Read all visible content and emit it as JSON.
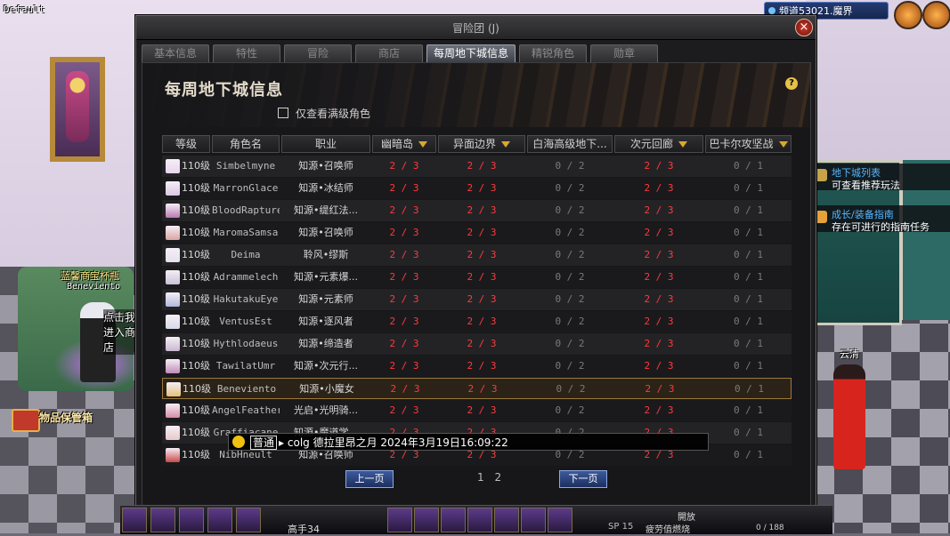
{
  "scene": {
    "corner_label": "Default",
    "channel": "频道53021.魔界",
    "shop_name": "蓝馨商宝杯瓶",
    "player_name": "Beneviento",
    "shop_hint": "点击我进入商店",
    "storage_label": "物品保管箱",
    "npc_name": "云清",
    "guide_items": [
      {
        "title": "地下城列表",
        "sub": "可查看推荐玩法"
      },
      {
        "title": "成长/装备指南",
        "sub": "存在可进行的指南任务"
      }
    ]
  },
  "window": {
    "title": "冒险团 (J)",
    "close": "×",
    "tabs": [
      "基本信息",
      "特性",
      "冒险",
      "商店",
      "每周地下城信息",
      "精锐角色",
      "勋章"
    ],
    "active_tab": 4,
    "heading": "每周地下城信息",
    "help": "?",
    "filter_label": "仅查看满级角色"
  },
  "table": {
    "headers": [
      "等级",
      "角色名",
      "职业",
      "幽暗岛",
      "异面边界",
      "白海高级地下...",
      "次元回廊",
      "巴卡尔攻坚战"
    ],
    "sortable": [
      false,
      false,
      false,
      true,
      true,
      true,
      true,
      true
    ],
    "rows": [
      {
        "level": "110级",
        "name": "Simbelmyne",
        "job": "知源•召唤师",
        "d1": "2 / 3",
        "d2": "2 / 3",
        "d3": "0 / 2",
        "d4": "2 / 3",
        "d5": "0 / 1"
      },
      {
        "level": "110级",
        "name": "MarronGlace",
        "job": "知源•冰结师",
        "d1": "2 / 3",
        "d2": "2 / 3",
        "d3": "0 / 2",
        "d4": "2 / 3",
        "d5": "0 / 1"
      },
      {
        "level": "110级",
        "name": "BloodRapture",
        "job": "知源•缇红法...",
        "d1": "2 / 3",
        "d2": "2 / 3",
        "d3": "0 / 2",
        "d4": "2 / 3",
        "d5": "0 / 1"
      },
      {
        "level": "110级",
        "name": "MaromaSamsa",
        "job": "知源•召唤师",
        "d1": "2 / 3",
        "d2": "2 / 3",
        "d3": "0 / 2",
        "d4": "2 / 3",
        "d5": "0 / 1"
      },
      {
        "level": "110级",
        "name": "Deima",
        "job": "聆风•缪斯",
        "d1": "2 / 3",
        "d2": "2 / 3",
        "d3": "0 / 2",
        "d4": "2 / 3",
        "d5": "0 / 1"
      },
      {
        "level": "110级",
        "name": "Adrammelech",
        "job": "知源•元素爆...",
        "d1": "2 / 3",
        "d2": "2 / 3",
        "d3": "0 / 2",
        "d4": "2 / 3",
        "d5": "0 / 1"
      },
      {
        "level": "110级",
        "name": "HakutakuEye",
        "job": "知源•元素师",
        "d1": "2 / 3",
        "d2": "2 / 3",
        "d3": "0 / 2",
        "d4": "2 / 3",
        "d5": "0 / 1"
      },
      {
        "level": "110级",
        "name": "VentusEst",
        "job": "知源•逐风者",
        "d1": "2 / 3",
        "d2": "2 / 3",
        "d3": "0 / 2",
        "d4": "2 / 3",
        "d5": "0 / 1"
      },
      {
        "level": "110级",
        "name": "Hythlodaeus",
        "job": "知源•缔造者",
        "d1": "2 / 3",
        "d2": "2 / 3",
        "d3": "0 / 2",
        "d4": "2 / 3",
        "d5": "0 / 1"
      },
      {
        "level": "110级",
        "name": "TawilatUmr",
        "job": "知源•次元行...",
        "d1": "2 / 3",
        "d2": "2 / 3",
        "d3": "0 / 2",
        "d4": "2 / 3",
        "d5": "0 / 1"
      },
      {
        "level": "110级",
        "name": "Beneviento",
        "job": "知源•小魔女",
        "d1": "2 / 3",
        "d2": "2 / 3",
        "d3": "0 / 2",
        "d4": "2 / 3",
        "d5": "0 / 1"
      },
      {
        "level": "110级",
        "name": "AngelFeather",
        "job": "光启•光明骑...",
        "d1": "2 / 3",
        "d2": "2 / 3",
        "d3": "0 / 2",
        "d4": "2 / 3",
        "d5": "0 / 1"
      },
      {
        "level": "110级",
        "name": "Graffiacane",
        "job": "知源•魔道学...",
        "d1": "2 / 3",
        "d2": "2 / 3",
        "d3": "0 / 2",
        "d4": "2 / 3",
        "d5": "0 / 1"
      },
      {
        "level": "110级",
        "name": "NibHneult",
        "job": "知源•召唤师",
        "d1": "2 / 3",
        "d2": "2 / 3",
        "d3": "0 / 2",
        "d4": "2 / 3",
        "d5": "0 / 1"
      }
    ],
    "selected_row": 10
  },
  "pager": {
    "prev": "上一页",
    "next": "下一页",
    "pages": [
      "1",
      "2"
    ],
    "current": "1"
  },
  "chat": {
    "channel": "普通",
    "text": "colg 德拉里昂之月 2024年3月19日16:09:22"
  },
  "hud": {
    "party": "高手34",
    "sp_label": "SP",
    "sp_value": "15",
    "status": "疲劳值燃烧",
    "open": "開放",
    "count": "0 / 188"
  }
}
